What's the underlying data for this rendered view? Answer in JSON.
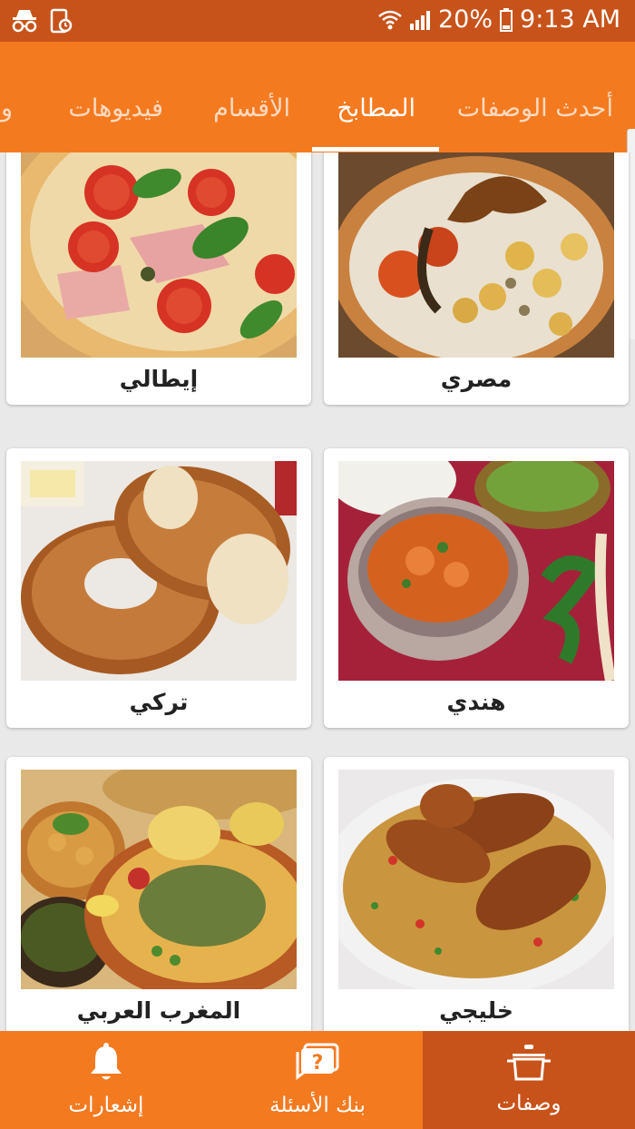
{
  "status_bar": {
    "battery": "20%",
    "time": "9:13 AM",
    "icons": [
      "incognito-icon",
      "screen-record-icon",
      "wifi-icon",
      "signal-icon",
      "battery-icon"
    ]
  },
  "tabs": [
    {
      "label": "أحدث الوصفات",
      "active": false
    },
    {
      "label": "المطابخ",
      "active": true
    },
    {
      "label": "الأقسام",
      "active": false
    },
    {
      "label": "فيديوهات",
      "active": false
    },
    {
      "label": "و",
      "active": false
    }
  ],
  "cuisines": [
    {
      "label": "مصري",
      "image": "koshari-photo"
    },
    {
      "label": "إيطالي",
      "image": "pizza-photo"
    },
    {
      "label": "هندي",
      "image": "curry-photo"
    },
    {
      "label": "تركي",
      "image": "simit-photo"
    },
    {
      "label": "خليجي",
      "image": "kabsa-photo"
    },
    {
      "label": "المغرب العربي",
      "image": "tagine-photo"
    }
  ],
  "bottom_nav": [
    {
      "label": "وصفات",
      "icon": "cooking-pot-icon",
      "active": true
    },
    {
      "label": "بنك الأسئلة",
      "icon": "question-chat-icon",
      "active": false
    },
    {
      "label": "إشعارات",
      "icon": "bell-icon",
      "active": false
    }
  ],
  "colors": {
    "accent": "#f47a20",
    "status_bar": "#c8531a",
    "active_nav": "#c8531a"
  }
}
